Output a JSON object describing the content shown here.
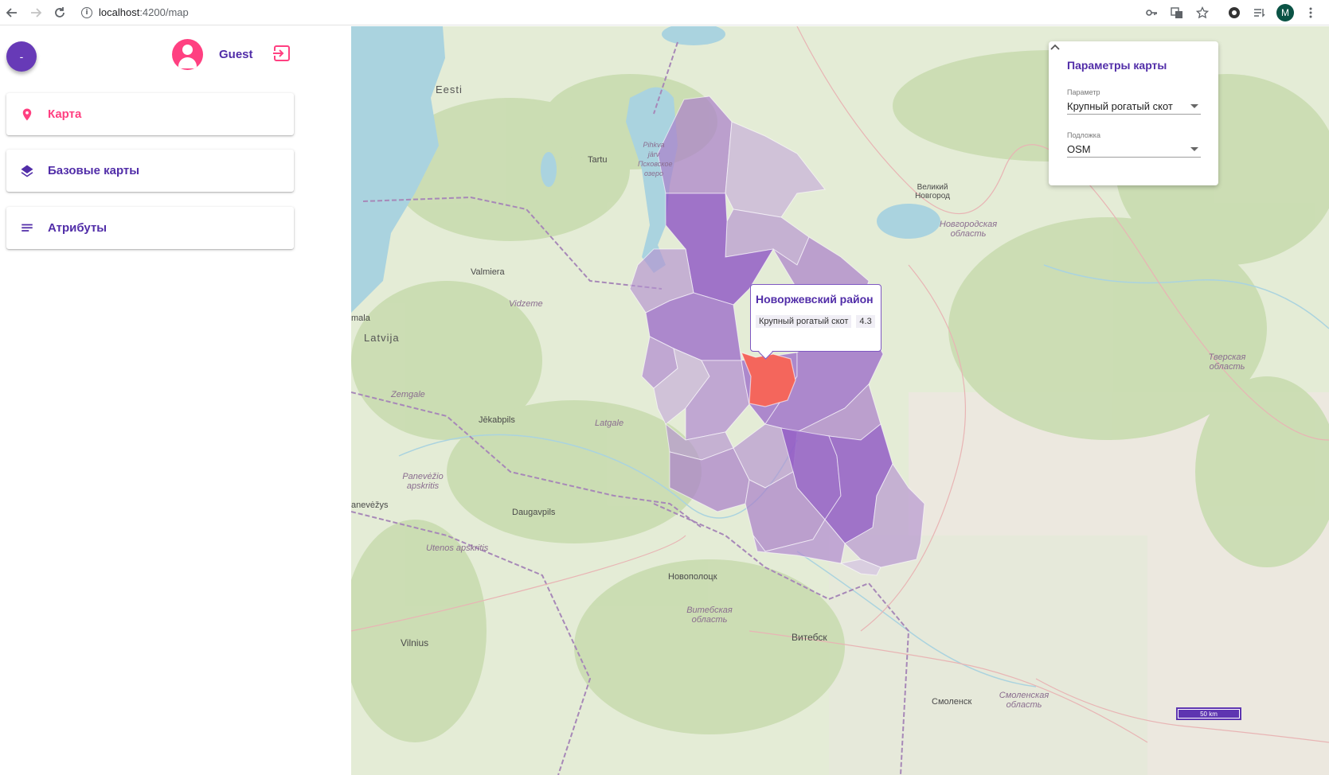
{
  "browser": {
    "url_host": "localhost",
    "url_path": ":4200/map",
    "profile_initial": "M"
  },
  "sidebar": {
    "menu_button_label": "-",
    "user_name": "Guest",
    "nav_items": [
      {
        "label": "Карта",
        "icon": "map-pin-icon",
        "active": true
      },
      {
        "label": "Базовые карты",
        "icon": "layers-icon",
        "active": false
      },
      {
        "label": "Атрибуты",
        "icon": "list-icon",
        "active": false
      }
    ]
  },
  "map": {
    "labels": [
      {
        "text": "Eesti",
        "kind": "country"
      },
      {
        "text": "Tartu",
        "kind": "city"
      },
      {
        "text": "Valmiera",
        "kind": "city"
      },
      {
        "text": "Vidzeme",
        "kind": "region"
      },
      {
        "text": "Latvija",
        "kind": "country"
      },
      {
        "text": "Zemgale",
        "kind": "region"
      },
      {
        "text": "Jēkabpils",
        "kind": "city"
      },
      {
        "text": "Latgale",
        "kind": "region"
      },
      {
        "text": "Panevėžio apskritis",
        "kind": "region"
      },
      {
        "text": "Daugavpils",
        "kind": "city"
      },
      {
        "text": "Utenos apskritis",
        "kind": "region"
      },
      {
        "text": "Vilnius",
        "kind": "city"
      },
      {
        "text": "Новополоцк",
        "kind": "city"
      },
      {
        "text": "Витебская область",
        "kind": "region"
      },
      {
        "text": "Витебск",
        "kind": "city"
      },
      {
        "text": "Смоленск",
        "kind": "city"
      },
      {
        "text": "Смоленская область",
        "kind": "region"
      },
      {
        "text": "Великий Новгород",
        "kind": "city"
      },
      {
        "text": "Новгородская область",
        "kind": "region"
      },
      {
        "text": "Тверская область",
        "kind": "region"
      },
      {
        "text": "Pihkva järv Псковское озеро",
        "kind": "region"
      },
      {
        "text": "mala",
        "kind": "city"
      },
      {
        "text": "anevėžys",
        "kind": "city"
      }
    ],
    "tooltip": {
      "title": "Новоржевский район",
      "attribute": "Крупный рогатый скот",
      "value": "4.3"
    },
    "panel": {
      "title": "Параметры карты",
      "param_label": "Параметр",
      "param_value": "Крупный рогатый скот",
      "basemap_label": "Подложка",
      "basemap_value": "OSM"
    },
    "scale_label": "50 km",
    "colors": {
      "accent": "#673ab7",
      "pink": "#ff4081",
      "highlight": "#f4665c"
    }
  }
}
